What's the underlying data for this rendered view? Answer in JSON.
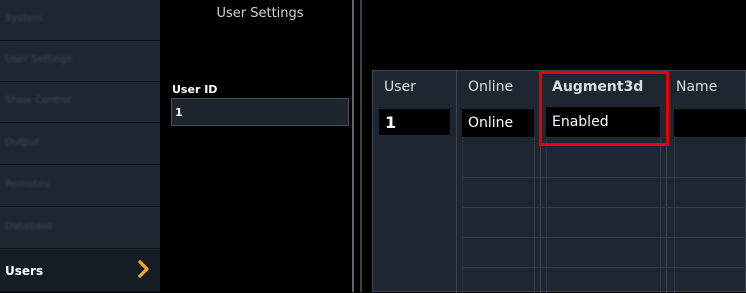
{
  "sidebar": {
    "items": [
      {
        "label": "System"
      },
      {
        "label": "User Settings"
      },
      {
        "label": "Show Control"
      },
      {
        "label": "Output"
      },
      {
        "label": "Remotes"
      },
      {
        "label": "Database"
      },
      {
        "label": "Users"
      }
    ],
    "chevron_color": "#f5a623"
  },
  "settings": {
    "title": "User Settings",
    "user_id_label": "User ID",
    "user_id_value": "1"
  },
  "table": {
    "columns": [
      "User",
      "Online",
      "Augment3d",
      "Name"
    ],
    "rows": [
      {
        "user": "1",
        "online": "Online",
        "augment3d": "Enabled",
        "name": ""
      }
    ],
    "highlight_color": "#e80000"
  }
}
